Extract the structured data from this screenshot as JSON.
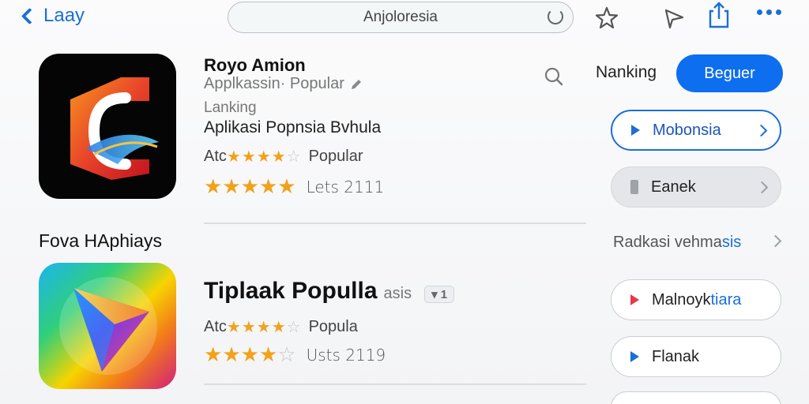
{
  "nav": {
    "back_label": "Laay",
    "search_text": "Anjoloresia"
  },
  "app1": {
    "name": "Royo Amion",
    "subtitle": "Applkassin· Popular",
    "ranking": "Lanking",
    "line": "Aplikasi Popnsia Bvhula",
    "rating_prefix": "Atc",
    "rating_label": "Popular",
    "rating_value": 3.5,
    "big_rating_value": 4.5,
    "count": "Lets 2111"
  },
  "section_title": "Fova HAphiays",
  "app2": {
    "name": "Tiplaak Populla",
    "name_suffix": "asis",
    "badge": "▾ 1",
    "rating_prefix": "Atc",
    "rating_label": "Popula",
    "rating_value": 3.5,
    "big_rating_value": 4,
    "count": "Usts 2119"
  },
  "sidebar": {
    "label": "Nanking",
    "primary_button": "Beguer",
    "pills": [
      {
        "label": "Mobonsia"
      },
      {
        "label": "Eanek"
      }
    ],
    "section_label_a": "Radkasi vehma",
    "section_label_b": "sis",
    "pills2": [
      {
        "label_a": "Malnoyk",
        "label_b": "tiara"
      },
      {
        "label": "Flanak"
      }
    ]
  },
  "colors": {
    "accent": "#0d6ef0",
    "star": "#f3a11a"
  },
  "icons": [
    "back-chevron-icon",
    "reload-icon",
    "star-icon",
    "send-icon",
    "share-icon",
    "more-icon",
    "search-icon",
    "pencil-icon",
    "play-icon",
    "chevron-right-icon"
  ]
}
